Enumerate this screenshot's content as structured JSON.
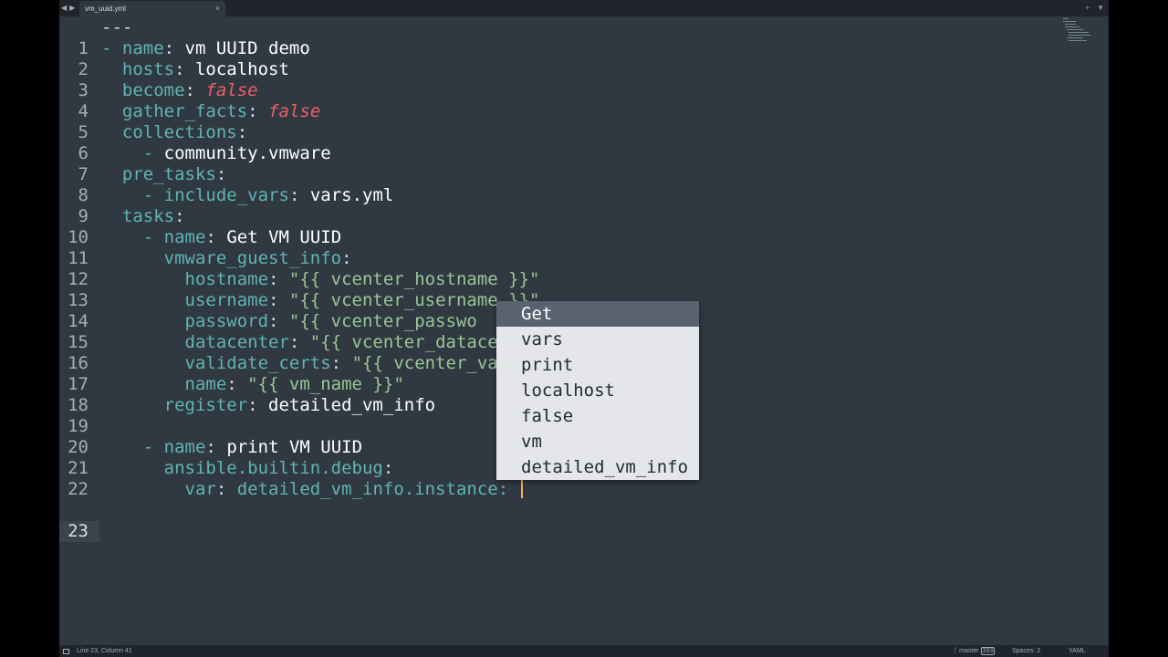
{
  "tab": {
    "title": "vm_uuid.yml",
    "close": "×"
  },
  "nav": {
    "back": "◀",
    "forward": "▶"
  },
  "window_controls": {
    "add": "+",
    "menu": "▼"
  },
  "editor": {
    "lines": [
      {
        "n": "1"
      },
      {
        "n": "2"
      },
      {
        "n": "3"
      },
      {
        "n": "4"
      },
      {
        "n": "5"
      },
      {
        "n": "6"
      },
      {
        "n": "7"
      },
      {
        "n": "8"
      },
      {
        "n": "9"
      },
      {
        "n": "10"
      },
      {
        "n": "11"
      },
      {
        "n": "12"
      },
      {
        "n": "13"
      },
      {
        "n": "14"
      },
      {
        "n": "15"
      },
      {
        "n": "16"
      },
      {
        "n": "17"
      },
      {
        "n": "18"
      },
      {
        "n": "19"
      },
      {
        "n": "20"
      },
      {
        "n": "21"
      },
      {
        "n": "22"
      },
      {
        "n": "23"
      }
    ],
    "code": {
      "l1": "---",
      "l2_dash": "- ",
      "l2_key": "name",
      "l2_val": "vm UUID demo",
      "l3_key": "hosts",
      "l3_val": "localhost",
      "l4_key": "become",
      "l4_val": "false",
      "l5_key": "gather_facts",
      "l5_val": "false",
      "l6_key": "collections",
      "l7_dash": "- ",
      "l7_val": "community.vmware",
      "l8_key": "pre_tasks",
      "l9_dash": "- ",
      "l9_key": "include_vars",
      "l9_val": "vars.yml",
      "l10_key": "tasks",
      "l11_dash": "- ",
      "l11_key": "name",
      "l11_val": "Get VM UUID",
      "l12_key": "vmware_guest_info",
      "l13_key": "hostname",
      "l13_val": "\"{{ vcenter_hostname }}\"",
      "l14_key": "username",
      "l14_val": "\"{{ vcenter_username }}\"",
      "l15_key": "password",
      "l15_val": "\"{{ vcenter_passwo",
      "l16_key": "datacenter",
      "l16_val": "\"{{ vcenter_datace",
      "l17_key": "validate_certs",
      "l17_val": "\"{{ vcenter_va",
      "l18_key": "name",
      "l18_val": "\"{{ vm_name }}\"",
      "l19_key": "register",
      "l19_val": "detailed_vm_info",
      "l21_dash": "- ",
      "l21_key": "name",
      "l21_val": "print VM UUID",
      "l22_key": "ansible.builtin.debug",
      "l23_key": "var",
      "l23_val": "detailed_vm_info.instance:"
    }
  },
  "autocomplete": {
    "items": [
      "Get",
      "vars",
      "print",
      "localhost",
      "false",
      "vm",
      "detailed_vm_info"
    ],
    "selected_index": 0
  },
  "statusbar": {
    "position": "Line 23, Column 41",
    "branch": "master",
    "branch_count": "393",
    "indent": "Spaces: 2",
    "syntax": "YAML"
  },
  "colors": {
    "background": "#303841",
    "key": "#5fb4b4",
    "boolean": "#ec5f66",
    "string": "#99c794",
    "caret": "#f9ae58"
  }
}
